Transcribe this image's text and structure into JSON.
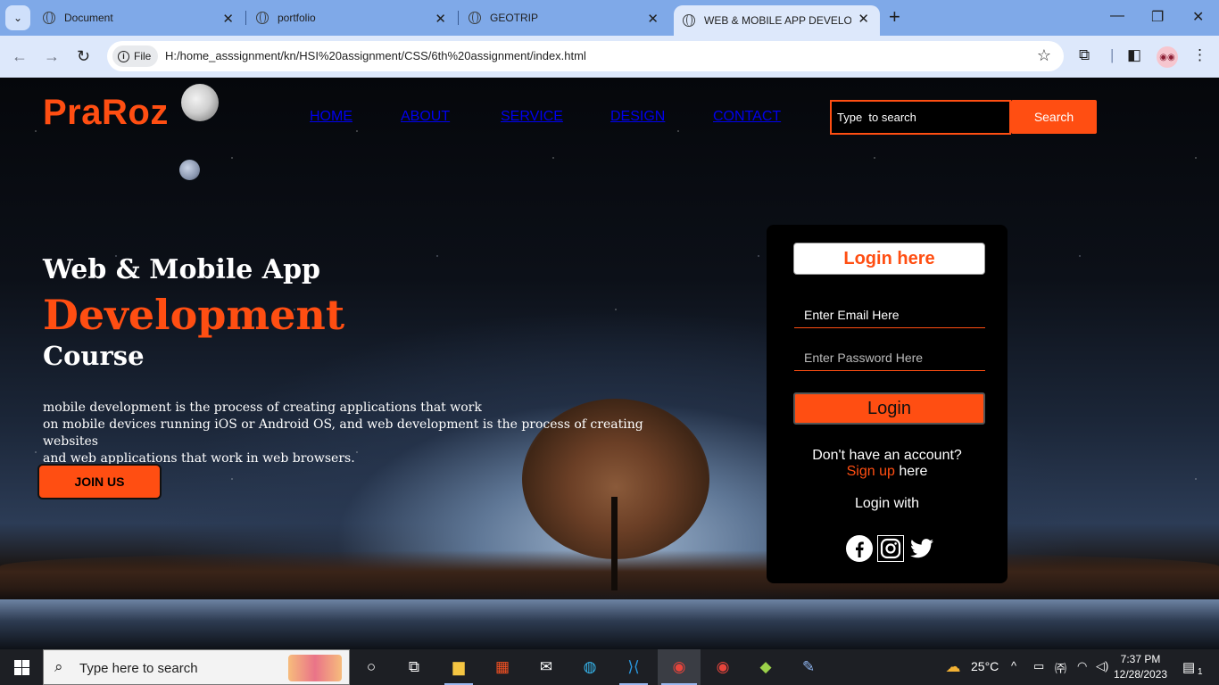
{
  "browser": {
    "tabs": [
      {
        "title": "Document"
      },
      {
        "title": "portfolio"
      },
      {
        "title": "GEOTRIP"
      },
      {
        "title": "WEB & MOBILE APP DEVELOPM"
      }
    ],
    "file_chip": "File",
    "url": "H:/home_asssignment/kn/HSI%20assignment/CSS/6th%20assignment/index.html"
  },
  "site": {
    "brand": "PraRoz",
    "nav": [
      "HOME",
      "ABOUT",
      "SERVICE",
      "DESIGN",
      "CONTACT"
    ],
    "search": {
      "placeholder": "Type  to search",
      "button": "Search"
    },
    "hero": {
      "line1": "Web & Mobile App",
      "line2": "Development",
      "line3": "Course",
      "description_lines": [
        "mobile development is the process of creating applications that work",
        "on mobile devices running iOS or Android OS, and web development is the process of creating websites",
        "and web applications that work in web browsers."
      ],
      "join_button": "JOIN US"
    },
    "login": {
      "title": "Login here",
      "email_placeholder": "Enter Email Here",
      "password_placeholder": "Enter Password Here",
      "button": "Login",
      "no_account": "Don't have an account?",
      "signup_link": "Sign up",
      "signup_suffix": "here",
      "login_with": "Login with",
      "socials": [
        "facebook-icon",
        "instagram-icon",
        "twitter-icon"
      ]
    },
    "colors": {
      "accent": "#ff4e12",
      "card": "#000000"
    }
  },
  "taskbar": {
    "search_placeholder": "Type here to search",
    "weather": "25°C",
    "time": "7:37 PM",
    "date": "12/28/2023",
    "notification_count": "1"
  }
}
